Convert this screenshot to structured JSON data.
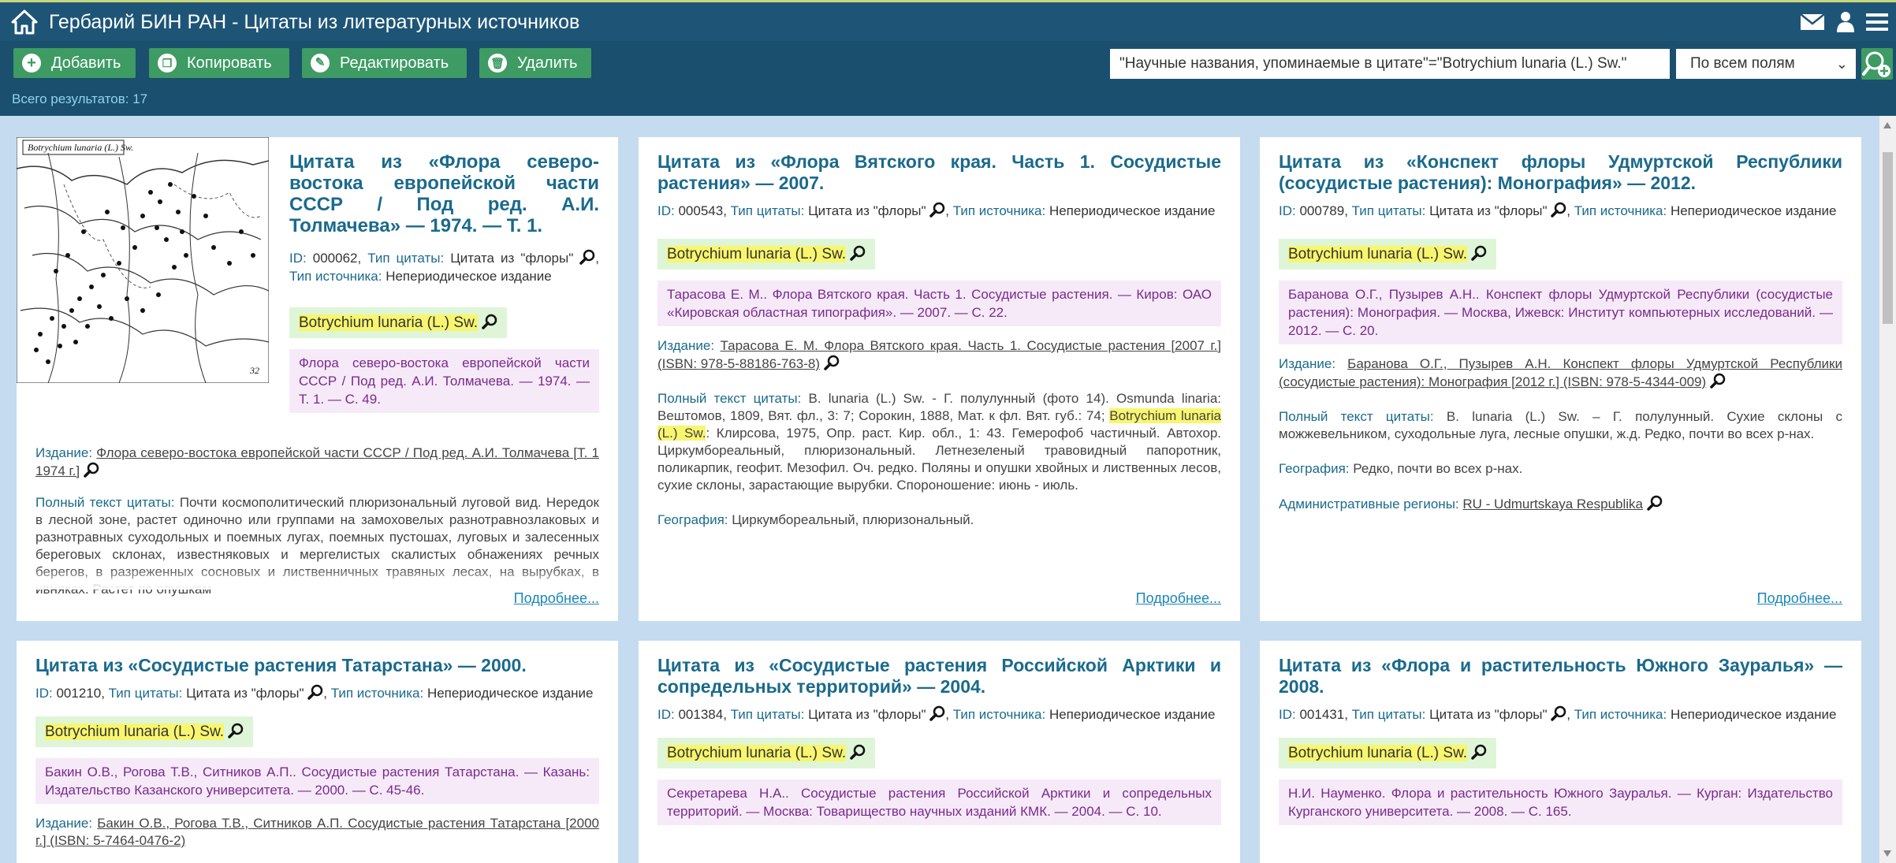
{
  "header": {
    "title": "Гербарий БИН РАН - Цитаты из литературных источников"
  },
  "toolbar": {
    "add": "Добавить",
    "copy": "Копировать",
    "edit": "Редактировать",
    "delete": "Удалить",
    "total": "Всего результатов: 17",
    "search_value": "\"Научные названия, упоминаемые в цитате\"=\"Botrychium lunaria (L.) Sw.\"",
    "scope": "По всем полям"
  },
  "labels": {
    "id": "ID:",
    "cite_type": "Тип цитаты:",
    "source_type": "Тип источника:",
    "edition": "Издание:",
    "fulltext": "Полный текст цитаты:",
    "geography": "География:",
    "regions": "Административные регионы:",
    "more": "Подробнее..."
  },
  "map": {
    "caption": "Botrychium lunaria (L.) Sw.",
    "page_no": "32"
  },
  "cards": [
    {
      "title": "Цитата из «Флора северо-востока европейской части СССР / Под ред. А.И. Толмачева» — 1974. — Т. 1.",
      "id": "000062,",
      "cite_type": "Цитата из \"флоры\"",
      "source_type": "Непериодическое издание",
      "species": "Botrychium lunaria (L.) Sw.",
      "ref": "Флора северо-востока европейской части СССР / Под ред. А.И. Толмачева. — 1974. — Т. 1. — С. 49.",
      "edition": "Флора северо-востока европейской части СССР / Под ред. А.И. Толмачева [Т. 1 1974 г.]",
      "fulltext": "Почти космополитический плюризональный луговой вид. Нередок в лесной зоне, растет одиночно или группами на замоховелых разнотравнозлаковых и разнотравных суходольных и поемных лугах, поемных пустошах, луговых и залесенных береговых склонах, известняковых и мергелистых скалистых обнажениях речных берегов, в разреженных сосновых и лиственничных травяных лесах, на вырубках, в ивняках. Растет по опушкам"
    },
    {
      "title": "Цитата из «Флора Вятского края. Часть 1. Сосудистые растения» — 2007.",
      "id": "000543,",
      "cite_type": "Цитата из \"флоры\"",
      "source_type": "Непериодическое издание",
      "species": "Botrychium lunaria (L.) Sw.",
      "ref": "Тарасова Е. М.. Флора Вятского края. Часть 1. Сосудистые растения. — Киров: ОАО «Кировская областная типография». — 2007. — С. 22.",
      "edition": "Тарасова Е. М. Флора Вятского края. Часть 1. Сосудистые растения [2007 г.] (ISBN: 978-5-88186-763-8)",
      "fulltext_a": "B. lunaria (L.) Sw. - Г. полулунный (фото 14). Osmunda linaria: Вештомов, 1809, Вят. фл., 3: 7; Сорокин, 1888, Мат. к фл. Вят. губ.: 74;",
      "fulltext_hl": "Botrychium lunaria (L.) Sw.",
      "fulltext_b": ": Клирсова, 1975, Опр. раст. Кир. обл., 1: 43. Гемерофоб частичный. Автохор. Циркумбореальный, плюризональный. Летнезеленый травовидный папоротник, поликарпик, геофит. Мезофил. Оч. редко. Поляны и опушки хвойных и лиственных лесов, сухие склоны, зарастающие вырубки. Спороношение: июнь - июль.",
      "geography": "Циркумбореальный, плюризональный."
    },
    {
      "title": "Цитата из «Конспект флоры Удмуртской Республики (сосудистые растения): Монография» — 2012.",
      "id": "000789,",
      "cite_type": "Цитата из \"флоры\"",
      "source_type": "Непериодическое издание",
      "species": "Botrychium lunaria (L.) Sw.",
      "ref": "Баранова О.Г., Пузырев А.Н.. Конспект флоры Удмуртской Республики (сосудистые растения): Монография. — Москва, Ижевск: Институт компьютерных исследований. — 2012. — С. 20.",
      "edition": "Баранова О.Г., Пузырев А.Н. Конспект флоры Удмуртской Республики (сосудистые растения): Монография [2012 г.] (ISBN: 978-5-4344-009)",
      "fulltext": "B. lunaria (L.) Sw. – Г. полулунный. Сухие склоны с можжевельником, суходольные луга, лесные опушки, ж.д. Редко, почти во всех р-нах.",
      "geography": "Редко, почти во всех р-нах.",
      "regions": "RU - Udmurtskaya Respublika"
    },
    {
      "title": "Цитата из «Сосудистые растения Татарстана» — 2000.",
      "id": "001210,",
      "cite_type": "Цитата из \"флоры\"",
      "source_type": "Непериодическое издание",
      "species": "Botrychium lunaria (L.) Sw.",
      "ref": "Бакин О.В., Рогова Т.В., Ситников А.П.. Сосудистые растения Татарстана. — Казань: Издательство Казанского университета. — 2000. — С. 45-46.",
      "edition": "Бакин О.В., Рогова Т.В., Ситников А.П. Сосудистые растения Татарстана [2000 г.] (ISBN: 5-7464-0476-2)"
    },
    {
      "title": "Цитата из «Сосудистые растения Российской Арктики и сопредельных территорий» — 2004.",
      "id": "001384,",
      "cite_type": "Цитата из \"флоры\"",
      "source_type": "Непериодическое издание",
      "species": "Botrychium lunaria (L.) Sw.",
      "ref": "Секретарева Н.А.. Сосудистые растения Российской Арктики и сопредельных территорий. — Москва: Товарищество научных изданий КМК. — 2004. — С. 10."
    },
    {
      "title": "Цитата из «Флора и растительность Южного Зауралья» — 2008.",
      "id": "001431,",
      "cite_type": "Цитата из \"флоры\"",
      "source_type": "Непериодическое издание",
      "species": "Botrychium lunaria (L.) Sw.",
      "ref": "Н.И. Науменко. Флора и растительность Южного Зауралья. — Курган: Издательство Курганского университета. — 2008. — С. 165."
    }
  ]
}
